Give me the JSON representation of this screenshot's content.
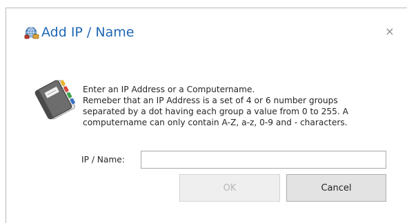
{
  "dialog": {
    "title": "Add IP / Name",
    "close_glyph": "×",
    "title_icon": "globe-network-icon",
    "message_icon": "address-book-icon",
    "message_lines": [
      "Enter an IP Address or a Computername.",
      "Remeber that an IP Address is a set of 4 or 6 number groups",
      "separated by a dot having each group a value  from 0 to 255. A",
      "computername can only contain A-Z, a-z, 0-9 and - characters."
    ],
    "field": {
      "label": "IP / Name:",
      "value": "",
      "placeholder": ""
    },
    "buttons": {
      "ok_label": "OK",
      "ok_enabled": false,
      "cancel_label": "Cancel"
    }
  },
  "colors": {
    "title": "#1e66b4",
    "text": "#262626",
    "disabled_text": "#b5b5b5",
    "border": "#b9b9b9"
  }
}
